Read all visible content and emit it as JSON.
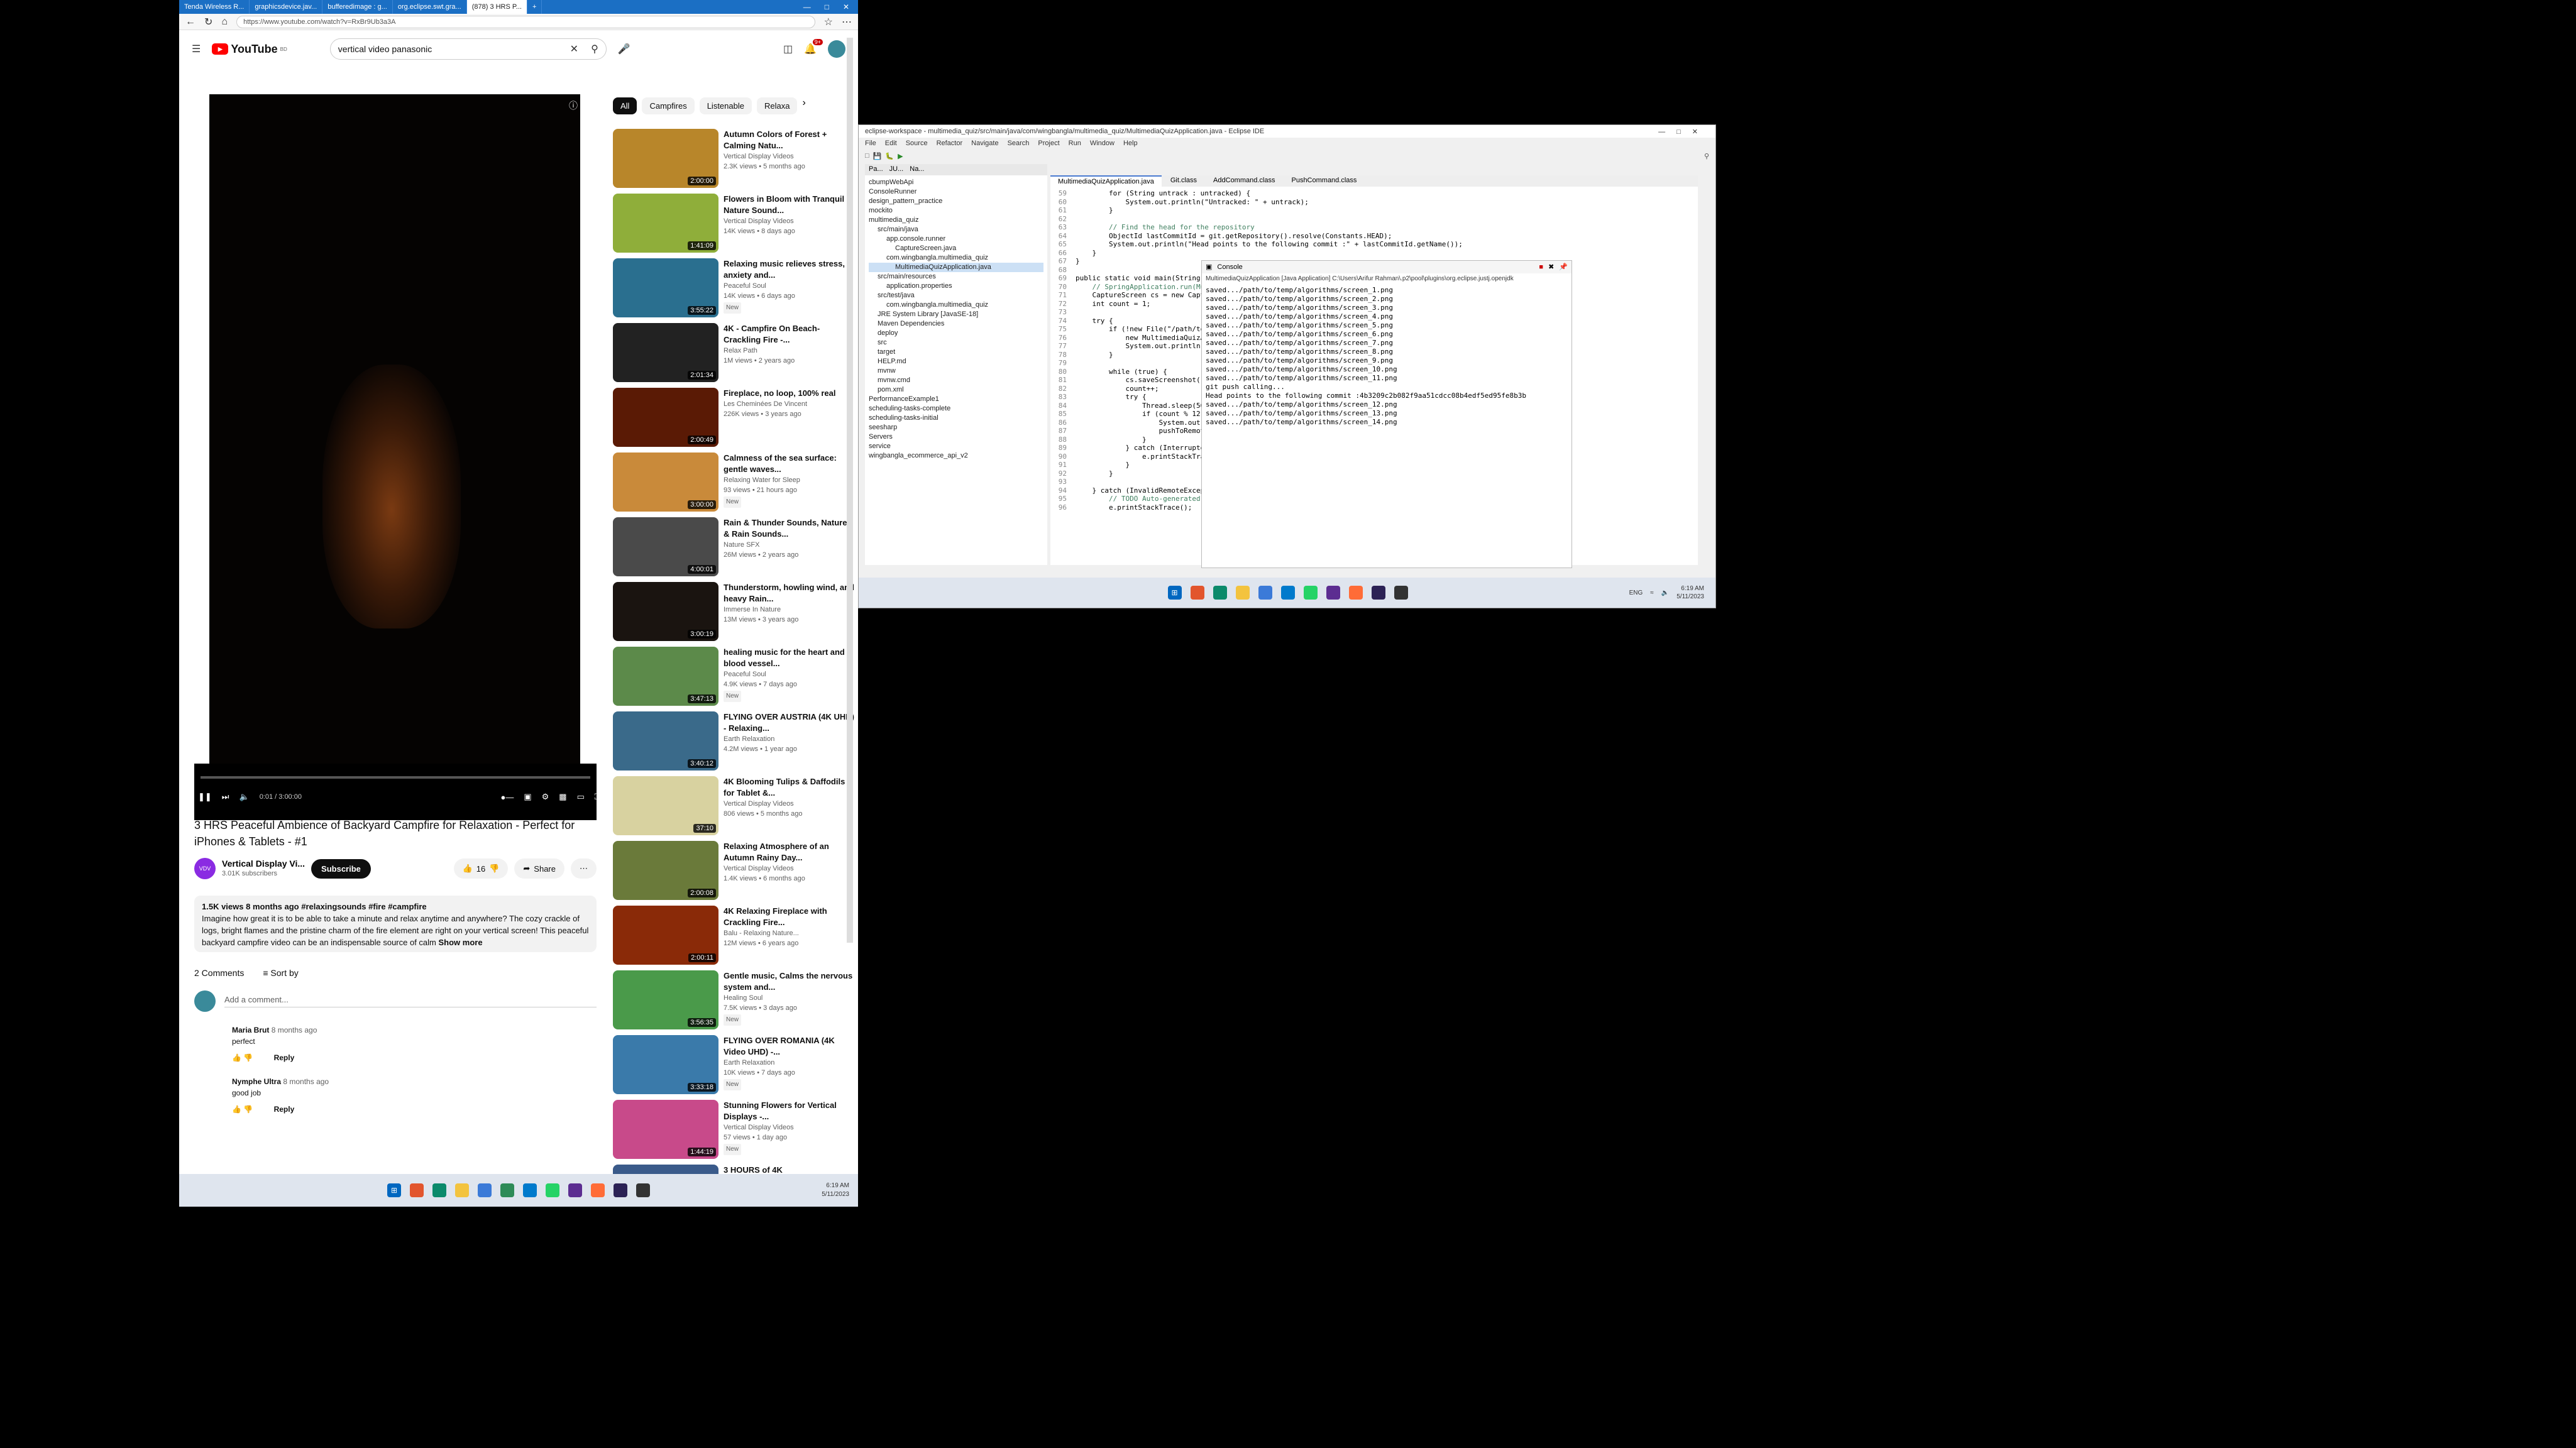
{
  "browser": {
    "tabs": [
      "Tenda Wireless R...",
      "graphicsdevice.jav...",
      "bufferedimage : g...",
      "org.eclipse.swt.gra...",
      "(878) 3 HRS P..."
    ],
    "url": "https://www.youtube.com/watch?v=RxBr9Ub3a3A",
    "newtab": "+"
  },
  "youtube": {
    "logo": "YouTube",
    "region": "BD",
    "search_value": "vertical video panasonic",
    "notifications": "9+",
    "time_display": "0:01 / 3:00:00",
    "title": "3 HRS Peaceful Ambience of Backyard Campfire for Relaxation - Perfect for iPhones & Tablets - #1",
    "channel": {
      "avatar": "VDV",
      "name": "Vertical Display Vi...",
      "subs": "3.01K subscribers",
      "subscribe": "Subscribe",
      "likes": "16",
      "share": "Share"
    },
    "description": {
      "meta": "1.5K views  8 months ago  #relaxingsounds #fire #campfire",
      "text": "Imagine how great it is to be able to take a minute and relax anytime and anywhere? The cozy crackle of logs, bright flames and the pristine charm of the fire element are right on your vertical screen! This peaceful backyard campfire video can be an indispensable source of calm",
      "more": "Show more"
    },
    "comments": {
      "count": "2 Comments",
      "sort": "Sort by",
      "add": "Add a comment...",
      "reply": "Reply",
      "items": [
        {
          "author": "Maria Brut",
          "age": "8 months ago",
          "text": "perfect"
        },
        {
          "author": "Nymphe Ultra",
          "age": "8 months ago",
          "text": "good job"
        }
      ]
    },
    "chips": [
      "All",
      "Campfires",
      "Listenable",
      "Relaxa"
    ],
    "recs": [
      {
        "title": "Autumn Colors of Forest + Calming Natu...",
        "channel": "Vertical Display Videos",
        "meta": "2.3K views • 5 months ago",
        "dur": "2:00:00",
        "color": "#b8862a"
      },
      {
        "title": "Flowers in Bloom with Tranquil Nature Sound...",
        "channel": "Vertical Display Videos",
        "meta": "14K views • 8 days ago",
        "dur": "1:41:09",
        "color": "#8fae3a"
      },
      {
        "title": "Relaxing music relieves stress, anxiety and...",
        "channel": "Peaceful Soul",
        "meta": "14K views • 6 days ago",
        "dur": "3:55:22",
        "color": "#2a6f8f",
        "badge": "New"
      },
      {
        "title": "4K - Campfire On Beach-Crackling Fire -...",
        "channel": "Relax Path",
        "meta": "1M views • 2 years ago",
        "dur": "2:01:34",
        "color": "#222222"
      },
      {
        "title": "Fireplace, no loop, 100% real",
        "channel": "Les Cheminées De Vincent",
        "meta": "226K views • 3 years ago",
        "dur": "2:00:49",
        "color": "#5a1a05"
      },
      {
        "title": "Calmness of the sea surface: gentle waves...",
        "channel": "Relaxing Water for Sleep",
        "meta": "93 views • 21 hours ago",
        "dur": "3:00:00",
        "color": "#c98a3a",
        "badge": "New"
      },
      {
        "title": "Rain & Thunder Sounds, Nature & Rain Sounds...",
        "channel": "Nature SFX",
        "meta": "26M views • 2 years ago",
        "dur": "4:00:01",
        "color": "#4a4a4a"
      },
      {
        "title": "Thunderstorm, howling wind, and heavy Rain...",
        "channel": "Immerse In Nature",
        "meta": "13M views • 3 years ago",
        "dur": "3:00:19",
        "color": "#1a1410"
      },
      {
        "title": "healing music for the heart and blood vessel...",
        "channel": "Peaceful Soul",
        "meta": "4.9K views • 7 days ago",
        "dur": "3:47:13",
        "color": "#5c8a4a",
        "badge": "New"
      },
      {
        "title": "FLYING OVER AUSTRIA (4K UHD) - Relaxing...",
        "channel": "Earth Relaxation",
        "meta": "4.2M views • 1 year ago",
        "dur": "3:40:12",
        "color": "#3a6a8a"
      },
      {
        "title": "4K Blooming Tulips & Daffodils for Tablet &...",
        "channel": "Vertical Display Videos",
        "meta": "806 views • 5 months ago",
        "dur": "37:10",
        "color": "#d8d2a0"
      },
      {
        "title": "Relaxing Atmosphere of an Autumn Rainy Day...",
        "channel": "Vertical Display Videos",
        "meta": "1.4K views • 6 months ago",
        "dur": "2:00:08",
        "color": "#6a7a3a"
      },
      {
        "title": "4K Relaxing Fireplace with Crackling Fire...",
        "channel": "Balu - Relaxing Nature...",
        "meta": "12M views • 6 years ago",
        "dur": "2:00:11",
        "color": "#8a2a08"
      },
      {
        "title": "Gentle music, Calms the nervous system and...",
        "channel": "Healing Soul",
        "meta": "7.5K views • 3 days ago",
        "dur": "3:56:35",
        "color": "#4a9a4a",
        "badge": "New"
      },
      {
        "title": "FLYING OVER ROMANIA (4K Video UHD) -...",
        "channel": "Earth Relaxation",
        "meta": "10K views • 7 days ago",
        "dur": "3:33:18",
        "color": "#3a7aaa",
        "badge": "New"
      },
      {
        "title": "Stunning Flowers for Vertical Displays -...",
        "channel": "Vertical Display Videos",
        "meta": "57 views • 1 day ago",
        "dur": "1:44:19",
        "color": "#c84a8a",
        "badge": "New"
      },
      {
        "title": "3 HOURS of 4K",
        "channel": "",
        "meta": "",
        "dur": "",
        "color": "#3a5a8a"
      }
    ]
  },
  "taskbar_left": {
    "time": "6:19 AM",
    "date": "5/11/2023"
  },
  "eclipse": {
    "title": "eclipse-workspace - multimedia_quiz/src/main/java/com/wingbangla/multimedia_quiz/MultimediaQuizApplication.java - Eclipse IDE",
    "menu": [
      "File",
      "Edit",
      "Source",
      "Refactor",
      "Navigate",
      "Search",
      "Project",
      "Run",
      "Window",
      "Help"
    ],
    "panes": [
      "Pa...",
      "JU...",
      "Na..."
    ],
    "tree": [
      "cbumpWebApi",
      "ConsoleRunner",
      "design_pattern_practice",
      "mockito",
      "multimedia_quiz",
      "src/main/java",
      "app.console.runner",
      "CaptureScreen.java",
      "com.wingbangla.multimedia_quiz",
      "MultimediaQuizApplication.java",
      "src/main/resources",
      "application.properties",
      "src/test/java",
      "com.wingbangla.multimedia_quiz",
      "JRE System Library [JavaSE-18]",
      "Maven Dependencies",
      "deploy",
      "src",
      "target",
      "HELP.md",
      "mvnw",
      "mvnw.cmd",
      "pom.xml",
      "PerformanceExample1",
      "scheduling-tasks-complete",
      "scheduling-tasks-initial",
      "seesharp",
      "Servers",
      "service",
      "wingbangla_ecommerce_api_v2"
    ],
    "editor_tabs": [
      "MultimediaQuizApplication.java",
      "Git.class",
      "AddCommand.class",
      "PushCommand.class"
    ],
    "code": [
      {
        "n": "59",
        "t": "        for (String untrack : untracked) {"
      },
      {
        "n": "60",
        "t": "            System.out.println(\"Untracked: \" + untrack);"
      },
      {
        "n": "61",
        "t": "        }"
      },
      {
        "n": "62",
        "t": ""
      },
      {
        "n": "63",
        "t": "        // Find the head for the repository"
      },
      {
        "n": "64",
        "t": "        ObjectId lastCommitId = git.getRepository().resolve(Constants.HEAD);"
      },
      {
        "n": "65",
        "t": "        System.out.println(\"Head points to the following commit :\" + lastCommitId.getName());"
      },
      {
        "n": "66",
        "t": "    }"
      },
      {
        "n": "67",
        "t": "}"
      },
      {
        "n": "68",
        "t": ""
      },
      {
        "n": "69",
        "t": "public static void main(String[] args) throws Illega"
      },
      {
        "n": "70",
        "t": "    // SpringApplication.run(MultimediaQuizApplicatio"
      },
      {
        "n": "71",
        "t": "    CaptureScreen cs = new CaptureScreen();"
      },
      {
        "n": "72",
        "t": "    int count = 1;"
      },
      {
        "n": "73",
        "t": ""
      },
      {
        "n": "74",
        "t": "    try {"
      },
      {
        "n": "75",
        "t": "        if (!new File(\"/path/to/temp\").exists()) {"
      },
      {
        "n": "76",
        "t": "            new MultimediaQuizApplication().cloneGit"
      },
      {
        "n": "77",
        "t": "            System.out.println(\"cloned...\");"
      },
      {
        "n": "78",
        "t": "        }"
      },
      {
        "n": "79",
        "t": ""
      },
      {
        "n": "80",
        "t": "        while (true) {"
      },
      {
        "n": "81",
        "t": "            cs.saveScreenshot(\"/path/to/temp/algorit"
      },
      {
        "n": "82",
        "t": "            count++;"
      },
      {
        "n": "83",
        "t": "            try {"
      },
      {
        "n": "84",
        "t": "                Thread.sleep(5000);"
      },
      {
        "n": "85",
        "t": "                if (count % 12 == 0) {"
      },
      {
        "n": "86",
        "t": "                    System.out.println(\"git push cal"
      },
      {
        "n": "87",
        "t": "                    pushToRemote(count);"
      },
      {
        "n": "88",
        "t": "                }"
      },
      {
        "n": "89",
        "t": "            } catch (InterruptedException e) {"
      },
      {
        "n": "90",
        "t": "                e.printStackTrace();"
      },
      {
        "n": "91",
        "t": "            }"
      },
      {
        "n": "92",
        "t": "        }"
      },
      {
        "n": "93",
        "t": ""
      },
      {
        "n": "94",
        "t": "    } catch (InvalidRemoteException e) {"
      },
      {
        "n": "95",
        "t": "        // TODO Auto-generated catch block"
      },
      {
        "n": "96",
        "t": "        e.printStackTrace();"
      }
    ],
    "console": {
      "label": "Console",
      "sub": "MultimediaQuizApplication [Java Application] C:\\Users\\Arifur Rahman\\.p2\\pool\\plugins\\org.eclipse.justj.openjdk",
      "lines": [
        "saved.../path/to/temp/algorithms/screen_1.png",
        "saved.../path/to/temp/algorithms/screen_2.png",
        "saved.../path/to/temp/algorithms/screen_3.png",
        "saved.../path/to/temp/algorithms/screen_4.png",
        "saved.../path/to/temp/algorithms/screen_5.png",
        "saved.../path/to/temp/algorithms/screen_6.png",
        "saved.../path/to/temp/algorithms/screen_7.png",
        "saved.../path/to/temp/algorithms/screen_8.png",
        "saved.../path/to/temp/algorithms/screen_9.png",
        "saved.../path/to/temp/algorithms/screen_10.png",
        "saved.../path/to/temp/algorithms/screen_11.png",
        "git push calling...",
        "Head points to the following commit :4b3209c2b082f9aa51cdcc08b4edf5ed95fe8b3b",
        "saved.../path/to/temp/algorithms/screen_12.png",
        "saved.../path/to/temp/algorithms/screen_13.png",
        "saved.../path/to/temp/algorithms/screen_14.png"
      ]
    },
    "taskbar": {
      "lang": "ENG",
      "time": "6:19 AM",
      "date": "5/11/2023"
    }
  }
}
